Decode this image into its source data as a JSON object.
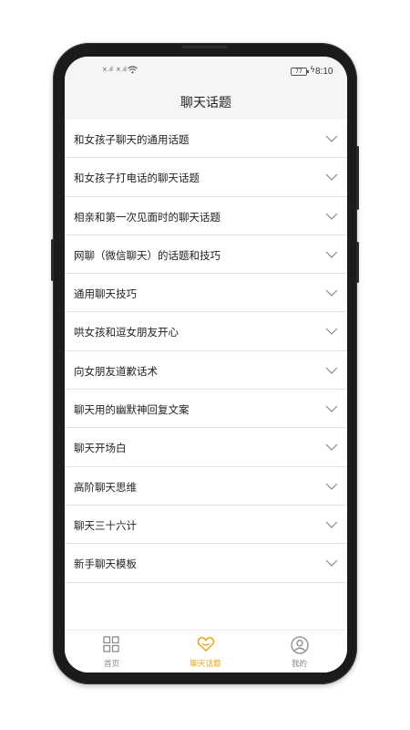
{
  "status_bar": {
    "time": "8:10",
    "battery": "77",
    "signal_1": "×.ıl",
    "signal_2": "×.ıl"
  },
  "header": {
    "title": "聊天话题"
  },
  "list": {
    "items": [
      {
        "label": "和女孩子聊天的通用话题"
      },
      {
        "label": "和女孩子打电话的聊天话题"
      },
      {
        "label": "相亲和第一次见面时的聊天话题"
      },
      {
        "label": "网聊（微信聊天）的话题和技巧"
      },
      {
        "label": "通用聊天技巧"
      },
      {
        "label": "哄女孩和逗女朋友开心"
      },
      {
        "label": "向女朋友道歉话术"
      },
      {
        "label": "聊天用的幽默神回复文案"
      },
      {
        "label": "聊天开场白"
      },
      {
        "label": "高阶聊天思维"
      },
      {
        "label": "聊天三十六计"
      },
      {
        "label": "新手聊天模板"
      }
    ],
    "icon": "chevron-down-icon"
  },
  "bottom_nav": {
    "items": [
      {
        "label": "首页",
        "icon": "grid-icon",
        "active": false
      },
      {
        "label": "聊天话题",
        "icon": "heart-chat-icon",
        "active": true
      },
      {
        "label": "我的",
        "icon": "user-icon",
        "active": false
      }
    ],
    "active_color": "#e8a317",
    "inactive_color": "#8a8a8a"
  }
}
